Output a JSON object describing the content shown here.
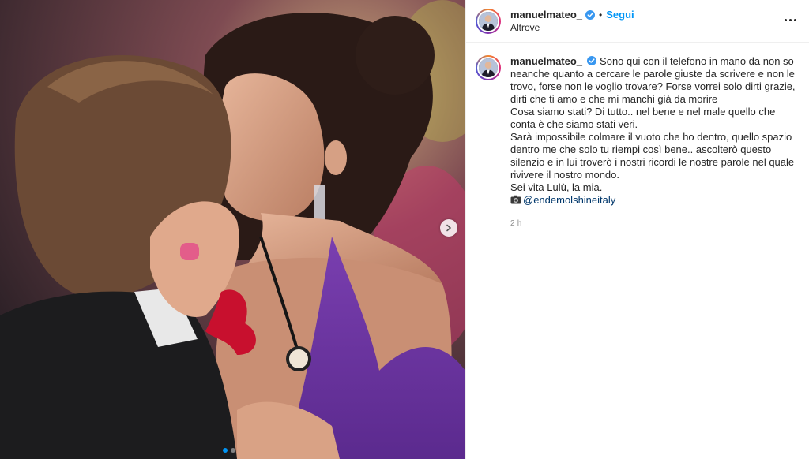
{
  "header": {
    "username": "manuelmateo_",
    "follow_label": "Segui",
    "bullet": "•",
    "location": "Altrove"
  },
  "caption": {
    "username": "manuelmateo_",
    "lines": [
      "Sono qui con il telefono in mano da non so neanche quanto a cercare le parole giuste da scrivere e non le trovo, forse non le voglio trovare? Forse vorrei solo dirti grazie, dirti che ti amo e che mi manchi già da morire",
      "Cosa siamo stati? Di tutto.. nel bene e nel male quello che conta è che siamo stati veri.",
      "Sarà impossibile colmare il vuoto che ho dentro, quello spazio dentro me che solo tu riempi così bene.. ascolterò questo silenzio e in lui troverò i nostri ricordi le nostre parole nel quale rivivere il nostro mondo.",
      "Sei vita Lulù, la mia."
    ],
    "credit_mention": "@endemolshineitaly",
    "timestamp": "2 h"
  },
  "carousel": {
    "total_slides": 2,
    "active_slide": 1
  },
  "icons": {
    "verified": "verified-badge-icon",
    "more": "more-options-icon",
    "next": "chevron-right-icon",
    "camera": "camera-emoji-icon"
  },
  "colors": {
    "accent": "#0095f6",
    "mention": "#00376b",
    "muted": "#8e8e8e"
  }
}
